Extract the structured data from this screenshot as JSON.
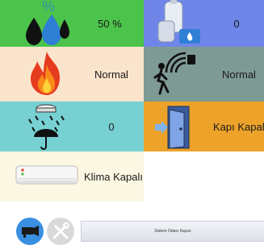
{
  "tiles": {
    "humidity": {
      "value": "50 %",
      "icon": "water-drops-icon",
      "color": "#4cc34a"
    },
    "gas": {
      "value": "0",
      "icon": "gas-cylinder-icon",
      "color": "#6f86e8"
    },
    "fire": {
      "value": "Normal",
      "icon": "fire-icon",
      "color": "#fbe4cc"
    },
    "motion": {
      "value": "Normal",
      "icon": "motion-sensor-icon",
      "color": "#7e9a94"
    },
    "rain": {
      "value": "0",
      "icon": "rain-sensor-icon",
      "color": "#77d1d3"
    },
    "door": {
      "value": "Kapı Kapalı",
      "icon": "door-icon",
      "color": "#eda32a"
    },
    "ac": {
      "value": "Klima Kapalı",
      "icon": "air-conditioner-icon",
      "color": "#fbf7e2"
    }
  },
  "bottom": {
    "camera_icon": "camera-icon",
    "tools_icon": "tools-icon",
    "status_text": "Sistem Odası Kapısı"
  }
}
